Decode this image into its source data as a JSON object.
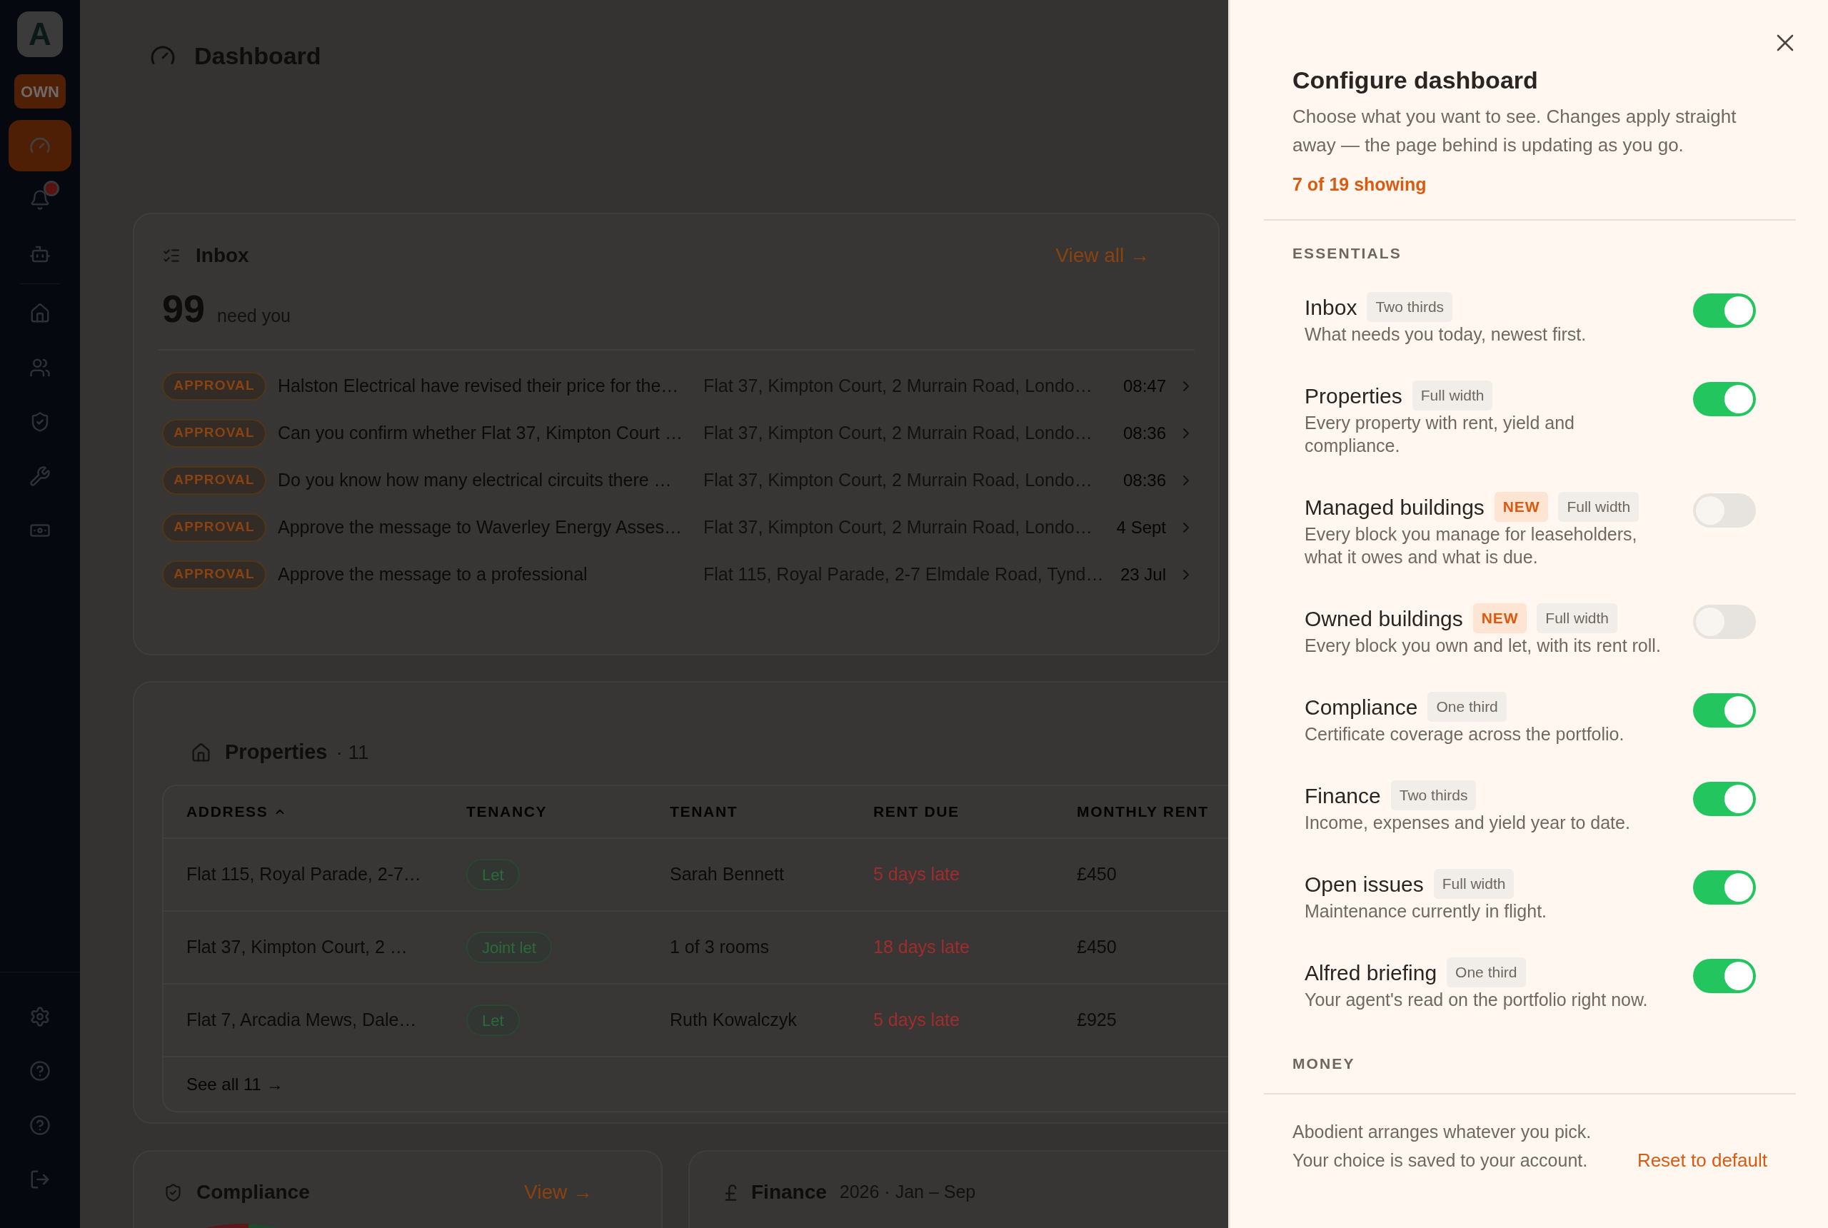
{
  "sidebar": {
    "logo": "A",
    "badge": "OWN",
    "nav_groups": [
      {
        "items": [
          {
            "selected": true,
            "alert": false
          },
          {
            "selected": false,
            "alert": true
          },
          {
            "selected": false,
            "alert": false
          }
        ]
      },
      {
        "items": [
          {
            "selected": false,
            "alert": false
          },
          {
            "selected": false,
            "alert": false
          },
          {
            "selected": false,
            "alert": false
          },
          {
            "selected": false,
            "alert": false
          },
          {
            "selected": false,
            "alert": false
          }
        ]
      }
    ],
    "bottom_items": [
      {
        "selected": false
      },
      {
        "selected": false
      },
      {
        "selected": false
      },
      {
        "selected": false
      }
    ]
  },
  "header": {
    "title": "Dashboard"
  },
  "inbox": {
    "title": "Inbox",
    "link": "View all →",
    "count": "99",
    "count_label": "need you",
    "rows": [
      {
        "tag": "APPROVAL",
        "title": "Halston Electrical have revised their price for the…",
        "address": "Flat 37, Kimpton Court, 2 Murrain Road, Londo…",
        "time": "08:47"
      },
      {
        "tag": "APPROVAL",
        "title": "Can you confirm whether Flat 37, Kimpton Court …",
        "address": "Flat 37, Kimpton Court, 2 Murrain Road, Londo…",
        "time": "08:36"
      },
      {
        "tag": "APPROVAL",
        "title": "Do you know how many electrical circuits there …",
        "address": "Flat 37, Kimpton Court, 2 Murrain Road, Londo…",
        "time": "08:36"
      },
      {
        "tag": "APPROVAL",
        "title": "Approve the message to Waverley Energy Asses…",
        "address": "Flat 37, Kimpton Court, 2 Murrain Road, Londo…",
        "time": "4 Sept"
      },
      {
        "tag": "APPROVAL",
        "title": "Approve the message to a professional",
        "address": "Flat 115, Royal Parade, 2-7 Elmdale Road, Tynd…",
        "time": "23 Jul"
      }
    ]
  },
  "properties": {
    "title": "Properties",
    "count": "· 11",
    "columns": [
      {
        "label": "ADDRESS",
        "sorted": true
      },
      {
        "label": "TENANCY",
        "sorted": false
      },
      {
        "label": "TENANT",
        "sorted": false
      },
      {
        "label": "RENT DUE",
        "sorted": false
      },
      {
        "label": "MONTHLY RENT",
        "sorted": false
      }
    ],
    "rows": [
      {
        "address": "Flat 115, Royal Parade, 2-7…",
        "tenancy": "Let",
        "tenant": "Sarah Bennett",
        "rent_due": "5 days late",
        "monthly_rent": "£450"
      },
      {
        "address": "Flat 37, Kimpton Court, 2 …",
        "tenancy": "Joint let",
        "tenant": "1 of 3 rooms",
        "rent_due": "18 days late",
        "monthly_rent": "£450"
      },
      {
        "address": "Flat 7, Arcadia Mews, Dale…",
        "tenancy": "Let",
        "tenant": "Ruth Kowalczyk",
        "rent_due": "5 days late",
        "monthly_rent": "£925"
      }
    ],
    "footer_link": "See all 11 →"
  },
  "compliance": {
    "title": "Compliance",
    "link": "View →"
  },
  "finance": {
    "title": "Finance",
    "period": "2026 · Jan – Sep"
  },
  "panel": {
    "title": "Configure dashboard",
    "description": "Choose what you want to see. Changes apply straight away — the page behind is updating as you go.",
    "summary": "7 of 19 showing",
    "sections": [
      {
        "heading": "ESSENTIALS",
        "widgets": [
          {
            "name": "Inbox",
            "tags": [
              {
                "kind": "size",
                "label": "Two thirds"
              }
            ],
            "description": "What needs you today, newest first.",
            "on": true
          },
          {
            "name": "Properties",
            "tags": [
              {
                "kind": "size",
                "label": "Full width"
              }
            ],
            "description": "Every property with rent, yield and compliance.",
            "on": true
          },
          {
            "name": "Managed buildings",
            "tags": [
              {
                "kind": "new",
                "label": "NEW"
              },
              {
                "kind": "size",
                "label": "Full width"
              }
            ],
            "description": "Every block you manage for leaseholders, what it owes and what is due.",
            "on": false
          },
          {
            "name": "Owned buildings",
            "tags": [
              {
                "kind": "new",
                "label": "NEW"
              },
              {
                "kind": "size",
                "label": "Full width"
              }
            ],
            "description": "Every block you own and let, with its rent roll.",
            "on": false
          },
          {
            "name": "Compliance",
            "tags": [
              {
                "kind": "size",
                "label": "One third"
              }
            ],
            "description": "Certificate coverage across the portfolio.",
            "on": true
          },
          {
            "name": "Finance",
            "tags": [
              {
                "kind": "size",
                "label": "Two thirds"
              }
            ],
            "description": "Income, expenses and yield year to date.",
            "on": true
          },
          {
            "name": "Open issues",
            "tags": [
              {
                "kind": "size",
                "label": "Full width"
              }
            ],
            "description": "Maintenance currently in flight.",
            "on": true
          },
          {
            "name": "Alfred briefing",
            "tags": [
              {
                "kind": "size",
                "label": "One third"
              }
            ],
            "description": "Your agent's read on the portfolio right now.",
            "on": true
          }
        ]
      },
      {
        "heading": "MONEY"
      }
    ],
    "footer": {
      "notes": [
        "Abodient arranges whatever you pick.",
        "Your choice is saved to your account."
      ],
      "reset": "Reset to default"
    }
  }
}
